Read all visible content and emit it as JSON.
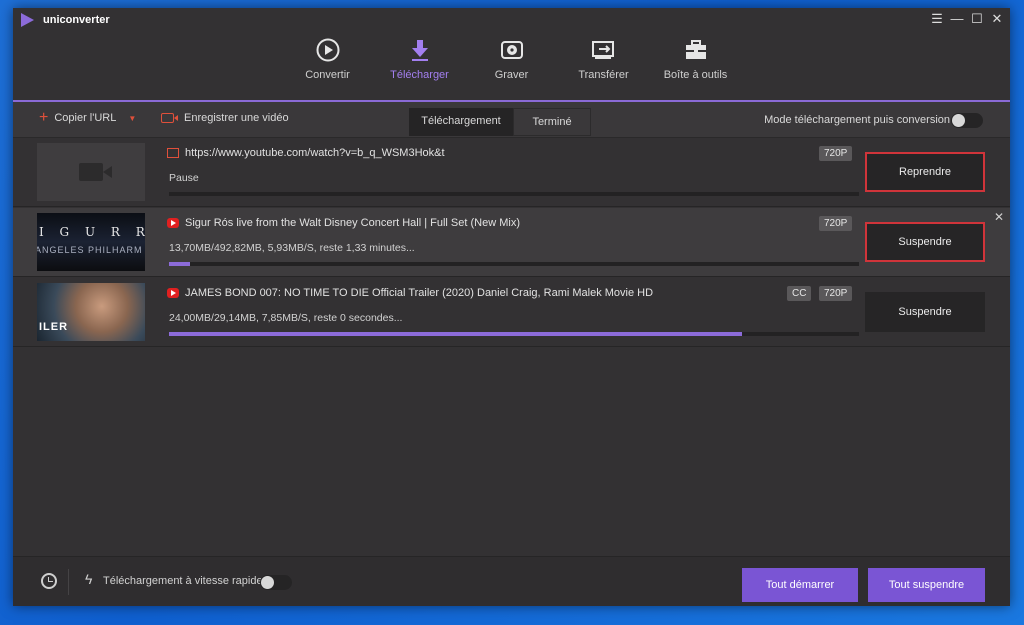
{
  "app": {
    "name": "uniconverter"
  },
  "window_controls": [
    "☰",
    "—",
    "☐",
    "✕"
  ],
  "nav": [
    {
      "label": "Convertir",
      "icon": "convert-icon",
      "active": false
    },
    {
      "label": "Télécharger",
      "icon": "download-icon",
      "active": true
    },
    {
      "label": "Graver",
      "icon": "burn-disc-icon",
      "active": false
    },
    {
      "label": "Transférer",
      "icon": "transfer-icon",
      "active": false
    },
    {
      "label": "Boîte à outils",
      "icon": "toolbox-icon",
      "active": false
    }
  ],
  "toolbar": {
    "copy_url": "Copier l'URL",
    "record_video": "Enregistrer une vidéo",
    "tabs": [
      "Téléchargement",
      "Terminé"
    ],
    "mode_label": "Mode téléchargement puis conversion",
    "mode_enabled": false
  },
  "downloads": [
    {
      "source_icon": "film-icon",
      "title": "https://www.youtube.com/watch?v=b_q_WSM3Hok&t",
      "status": "Pause",
      "badges": [
        "720P"
      ],
      "progress": 0,
      "action": "Reprendre"
    },
    {
      "source_icon": "youtube-icon",
      "title": "Sigur Rós live from the Walt Disney Concert Hall | Full Set (New Mix)",
      "status": "13,70MB/492,82MB, 5,93MB/S, reste 1,33 minutes...",
      "badges": [
        "720P"
      ],
      "progress": 0.03,
      "action": "Suspendre",
      "thumb_text": [
        "I G U R R Ó",
        "ANGELES PHILHARM"
      ]
    },
    {
      "source_icon": "youtube-icon",
      "title": "JAMES BOND 007: NO TIME TO DIE Official Trailer (2020) Daniel Craig, Rami Malek Movie HD",
      "status": "24,00MB/29,14MB, 7,85MB/S, reste 0 secondes...",
      "badges": [
        "CC",
        "720P"
      ],
      "progress": 0.83,
      "action": "Suspendre",
      "thumb_text": [
        "ILER"
      ]
    }
  ],
  "footer": {
    "fast_download": "Téléchargement à vitesse rapide",
    "fast_enabled": false,
    "start_all": "Tout démarrer",
    "pause_all": "Tout suspendre"
  },
  "colors": {
    "accent": "#8c6bd9",
    "button_purple": "#7a55d4",
    "highlight_red": "#d0343a",
    "youtube_red": "#e02020"
  }
}
